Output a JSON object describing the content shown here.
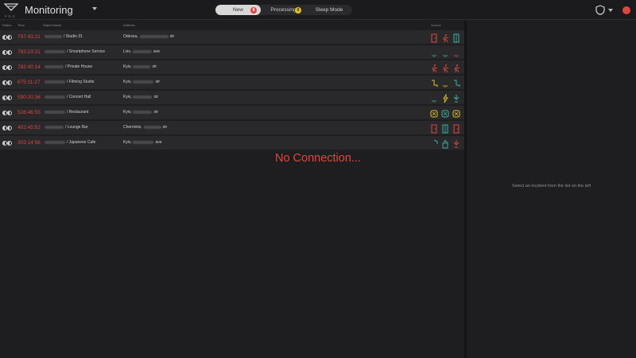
{
  "header": {
    "logo_text": "PRO",
    "title": "Monitoring",
    "tabs": [
      {
        "label": "New",
        "badge": "8",
        "active": true
      },
      {
        "label": "Processing",
        "badge": "0",
        "active": false
      },
      {
        "label": "Sleep Mode",
        "active": false
      }
    ]
  },
  "table": {
    "columns": [
      "Status",
      "Time",
      "Object Name",
      "Address",
      "Source"
    ],
    "rows": [
      {
        "time": "797:43:21",
        "object": "/ Studio 31",
        "address_city": "Odessa,",
        "address_suffix": "str",
        "sources": [
          "door-icon",
          "motion-icon",
          "window-icon"
        ],
        "colors": [
          "#e0473c",
          "#e0473c",
          "#35b5a0"
        ]
      },
      {
        "time": "793:23:31",
        "object": "/ Smartphone Service",
        "address_city": "Lviv,",
        "address_suffix": "ave",
        "sources": [
          "smoke-icon",
          "smoke-icon",
          "smoke-icon"
        ],
        "colors": [
          "#35b5a0",
          "#35b5a0",
          "#e0473c"
        ]
      },
      {
        "time": "782:40:14",
        "object": "/ Private House",
        "address_city": "Kyiv,",
        "address_suffix": "str",
        "sources": [
          "motion-icon",
          "motion-icon",
          "motion-icon"
        ],
        "colors": [
          "#e0473c",
          "#e0473c",
          "#e0473c"
        ]
      },
      {
        "time": "675:11:27",
        "object": "/ Filming Studio",
        "address_city": "Kyiv,",
        "address_suffix": "str",
        "sources": [
          "leak-icon",
          "smoke-icon",
          "leak-icon"
        ],
        "colors": [
          "#e1c22a",
          "#e1c22a",
          "#35b5a0"
        ]
      },
      {
        "time": "590:20:36",
        "object": "/ Concert Hall",
        "address_city": "Kyiv,",
        "address_suffix": "str",
        "sources": [
          "smoke-icon",
          "bolt-icon",
          "tamper-icon"
        ],
        "colors": [
          "#35b5a0",
          "#e1c22a",
          "#35b5a0"
        ]
      },
      {
        "time": "528:46:55",
        "object": "/ Restaurant",
        "address_city": "Kyiv,",
        "address_suffix": "str",
        "sources": [
          "glass-icon",
          "glass-icon",
          "glass-icon"
        ],
        "colors": [
          "#e1c22a",
          "#35b5a0",
          "#e1c22a"
        ]
      },
      {
        "time": "402:45:52",
        "object": "/ Lounge Bar",
        "address_city": "Chernivtsi,",
        "address_suffix": "str",
        "sources": [
          "door-icon",
          "window-icon",
          "door-icon"
        ],
        "colors": [
          "#e0473c",
          "#35b5a0",
          "#e0473c"
        ]
      },
      {
        "time": "303:14:56",
        "object": "/ Japanese Cafe",
        "address_city": "Kyiv,",
        "address_suffix": "ave",
        "sources": [
          "shield-icon",
          "hand-icon",
          "tamper-icon"
        ],
        "colors": [
          "#35b5a0",
          "#35b5a0",
          "#e0473c"
        ]
      }
    ]
  },
  "message": "No Connection...",
  "detail_hint": "Select an incident from the list on the left"
}
